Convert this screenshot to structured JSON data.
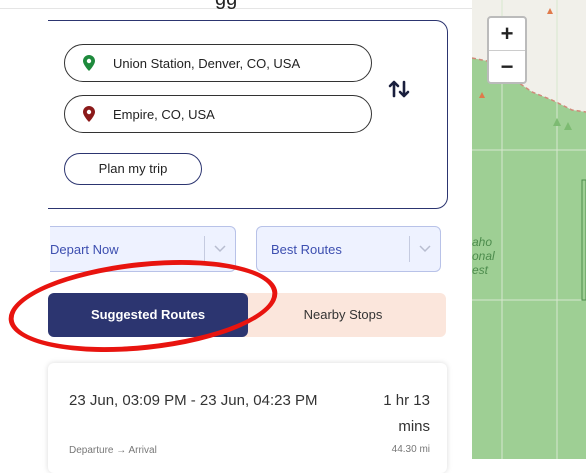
{
  "top_strip": {
    "text": "gg"
  },
  "trip": {
    "from": "Union Station, Denver, CO, USA",
    "to": "Empire, CO, USA",
    "plan_label": "Plan my trip",
    "swap_icon": "swap-vertical-icon"
  },
  "filters": {
    "depart_label": "Depart Now",
    "routes_label": "Best Routes"
  },
  "tabs": [
    {
      "label": "Suggested Routes"
    },
    {
      "label": "Nearby Stops"
    }
  ],
  "route": {
    "time_range": "23 Jun, 03:09 PM - 23 Jun, 04:23 PM",
    "subtitle": "Departure → Arrival",
    "duration": "1 hr 13 mins",
    "distance": "44.30 mi"
  },
  "map": {
    "zoom_in": "+",
    "zoom_out": "−",
    "forest_label_1": "aho",
    "forest_label_2": "onal",
    "forest_label_3": "est"
  },
  "colors": {
    "primary": "#2c3570",
    "pin_from": "#1e8a3c",
    "pin_to": "#8b1a1a",
    "dropdown_bg": "#eef2ff",
    "tab_inactive_bg": "#fbe6dc",
    "annotation": "#e8140f",
    "forest": "#9ecf94"
  }
}
